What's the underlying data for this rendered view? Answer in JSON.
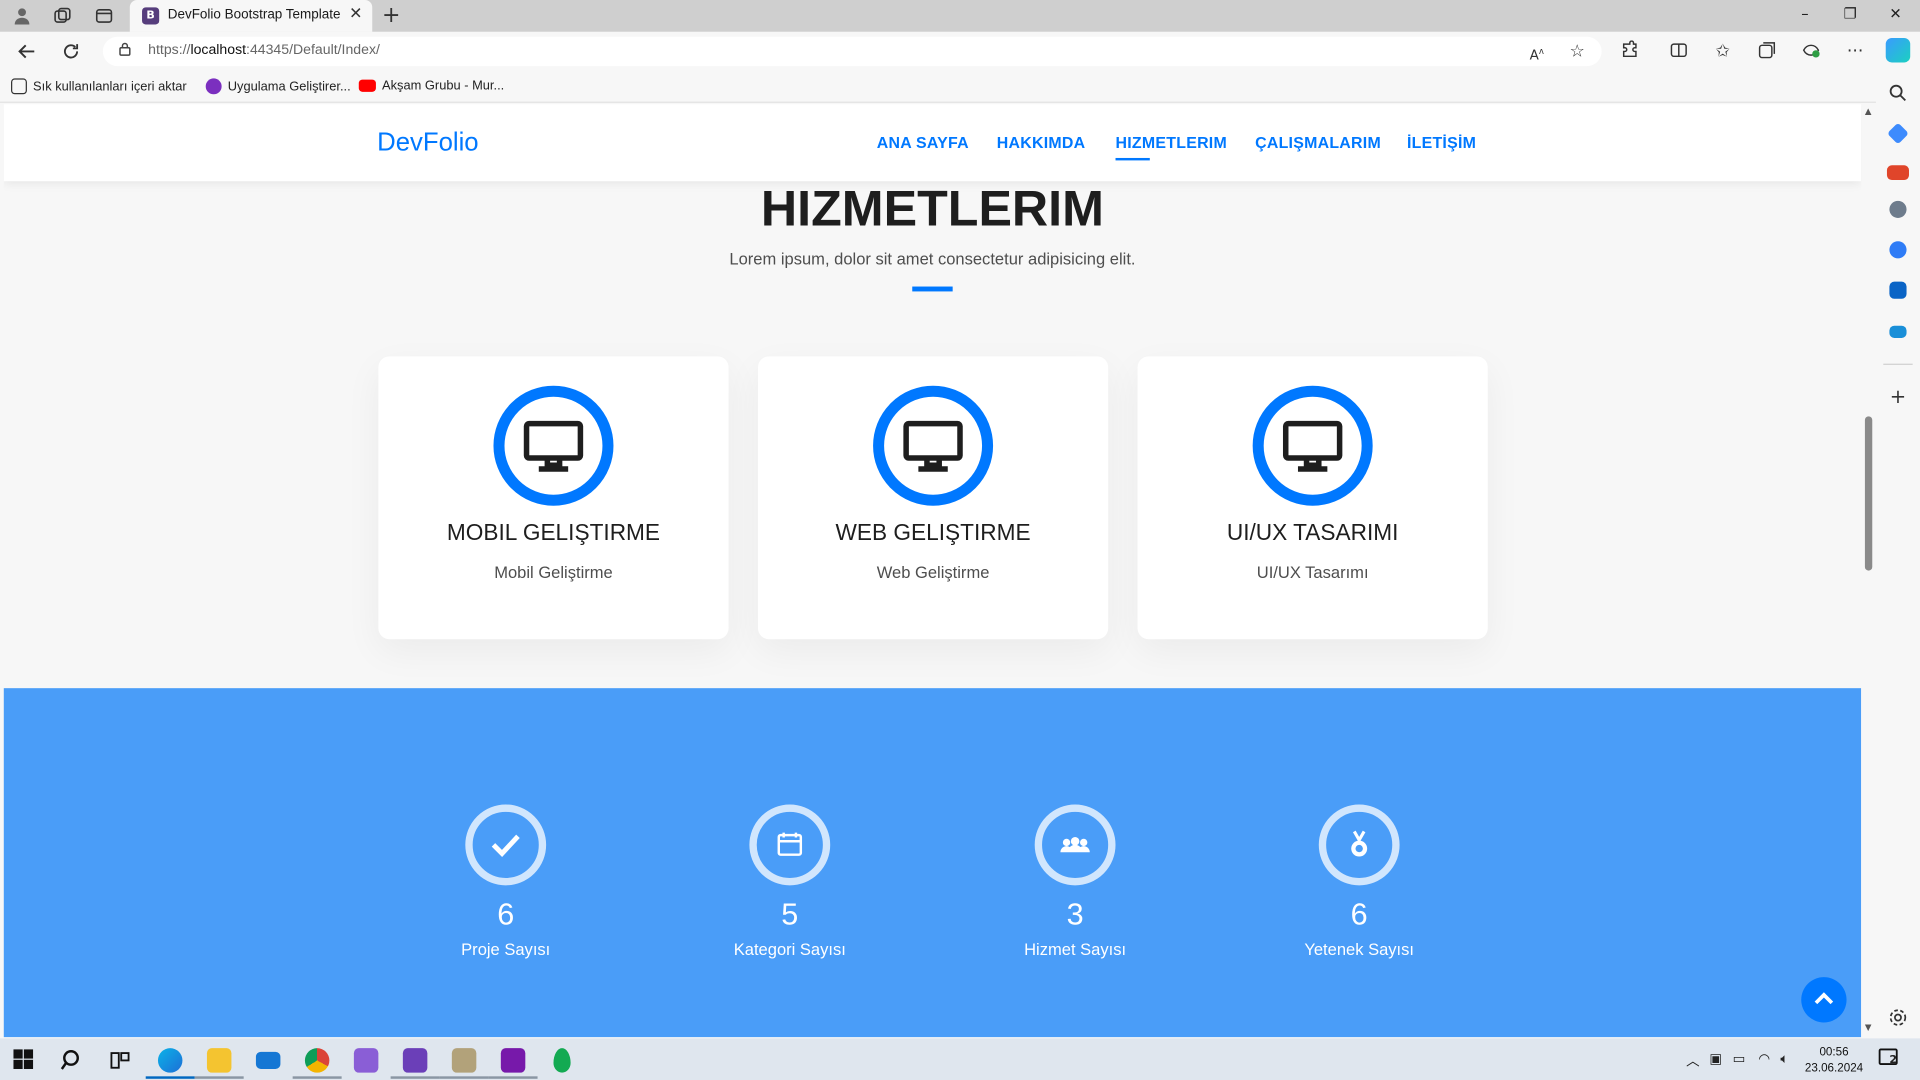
{
  "browser": {
    "tab_title": "DevFolio Bootstrap Template",
    "url_prefix": "https://",
    "url_host": "localhost",
    "url_rest": ":44345/Default/Index/",
    "bookmarks": [
      {
        "label": "Sık kullanılanları içeri aktar",
        "icon": "import-icon"
      },
      {
        "label": "Uygulama Geliştirer...",
        "icon": "purple-app-icon"
      },
      {
        "label": "Akşam Grubu - Mur...",
        "icon": "youtube-icon"
      }
    ]
  },
  "site": {
    "brand": "DevFolio",
    "nav": [
      "ANA SAYFA",
      "HAKKIMDA",
      "HIZMETLERIM",
      "ÇALIŞMALARIM",
      "İLETİŞİM"
    ],
    "active_nav": "HIZMETLERIM",
    "accent_color": "#0078ff",
    "counter_bg": "#4a9df8"
  },
  "services": {
    "title": "HIZMETLERIM",
    "subtitle": "Lorem ipsum, dolor sit amet consectetur adipisicing elit.",
    "cards": [
      {
        "title": "MOBIL GELIŞTIRME",
        "text": "Mobil Geliştirme",
        "icon": "monitor-icon"
      },
      {
        "title": "WEB GELIŞTIRME",
        "text": "Web Geliştirme",
        "icon": "monitor-icon"
      },
      {
        "title": "UI/UX TASARIMI",
        "text": "UI/UX Tasarımı",
        "icon": "monitor-icon"
      }
    ]
  },
  "counters": [
    {
      "value": "6",
      "label": "Proje Sayısı",
      "icon": "check-icon"
    },
    {
      "value": "5",
      "label": "Kategori Sayısı",
      "icon": "calendar-icon"
    },
    {
      "value": "3",
      "label": "Hizmet Sayısı",
      "icon": "people-icon"
    },
    {
      "value": "6",
      "label": "Yetenek Sayısı",
      "icon": "award-icon"
    }
  ],
  "taskbar": {
    "time": "00:56",
    "date": "23.06.2024",
    "notification_count": "2"
  }
}
